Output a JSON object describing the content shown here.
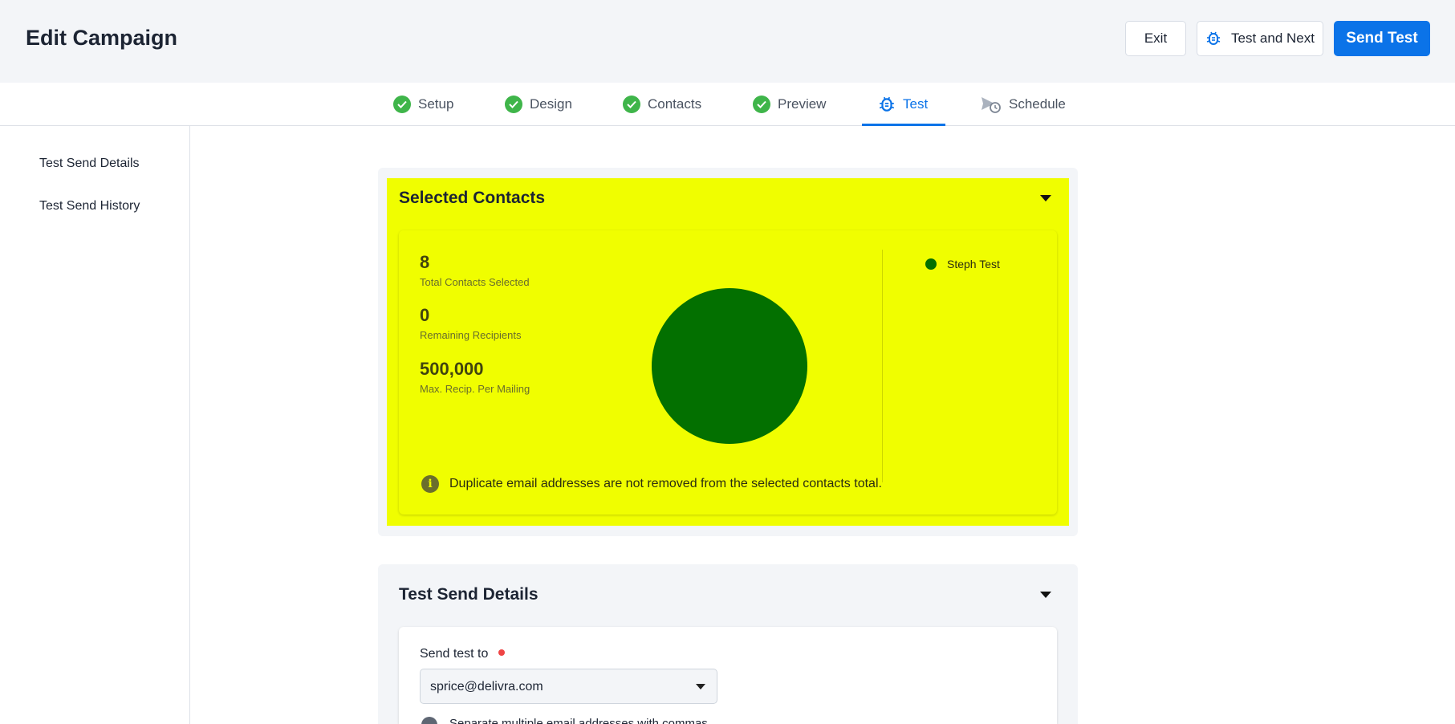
{
  "header": {
    "title": "Edit Campaign",
    "exit_label": "Exit",
    "test_next_label": "Test and Next",
    "send_test_label": "Send Test",
    "accent_color": "#0b73e8"
  },
  "tabs": [
    {
      "label": "Setup",
      "icon": "check-circle-icon",
      "state": "complete"
    },
    {
      "label": "Design",
      "icon": "check-circle-icon",
      "state": "complete"
    },
    {
      "label": "Contacts",
      "icon": "check-circle-icon",
      "state": "complete"
    },
    {
      "label": "Preview",
      "icon": "check-circle-icon",
      "state": "complete"
    },
    {
      "label": "Test",
      "icon": "bug-icon",
      "state": "active"
    },
    {
      "label": "Schedule",
      "icon": "schedule-send-icon",
      "state": "pending"
    }
  ],
  "sidebar": {
    "items": [
      {
        "label": "Test Send Details"
      },
      {
        "label": "Test Send History"
      }
    ]
  },
  "selected_contacts": {
    "title": "Selected Contacts",
    "highlight_color": "#f0fe00",
    "stats": [
      {
        "value": "8",
        "label": "Total Contacts Selected"
      },
      {
        "value": "0",
        "label": "Remaining Recipients"
      },
      {
        "value": "500,000",
        "label": "Max. Recip. Per Mailing"
      }
    ],
    "legend": [
      {
        "label": "Steph Test",
        "color": "#037000"
      }
    ],
    "info_text": "Duplicate email addresses are not removed from the selected contacts total."
  },
  "chart_data": {
    "type": "pie",
    "categories": [
      "Steph Test"
    ],
    "values": [
      8
    ],
    "colors": [
      "#037000"
    ],
    "legend_position": "right"
  },
  "test_send_details": {
    "title": "Test Send Details",
    "send_to_label": "Send test to",
    "send_to_value": "sprice@delivra.com",
    "hint": "Separate multiple email addresses with commas"
  }
}
